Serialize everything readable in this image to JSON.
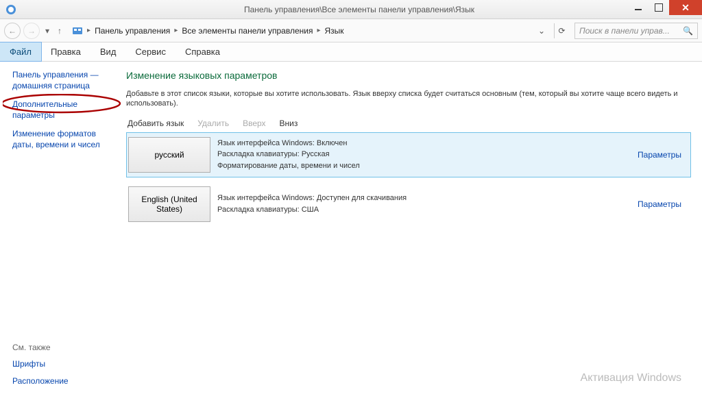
{
  "window": {
    "title": "Панель управления\\Все элементы панели управления\\Язык"
  },
  "nav": {
    "breadcrumb": [
      "Панель управления",
      "Все элементы панели управления",
      "Язык"
    ]
  },
  "search": {
    "placeholder": "Поиск в панели управ..."
  },
  "menu": {
    "file": "Файл",
    "edit": "Правка",
    "view": "Вид",
    "service": "Сервис",
    "help": "Справка"
  },
  "sidebar": {
    "home": "Панель управления — домашняя страница",
    "additional": "Дополнительные параметры",
    "dateformat": "Изменение форматов даты, времени и чисел",
    "see_also": "См. также",
    "fonts": "Шрифты",
    "location": "Расположение"
  },
  "content": {
    "heading": "Изменение языковых параметров",
    "description": "Добавьте в этот список языки, которые вы хотите использовать. Язык вверху списка будет считаться основным (тем, который вы хотите чаще всего видеть и использовать).",
    "toolbar": {
      "add": "Добавить язык",
      "remove": "Удалить",
      "up": "Вверх",
      "down": "Вниз"
    },
    "languages": [
      {
        "name": "русский",
        "line1": "Язык интерфейса Windows: Включен",
        "line2": "Раскладка клавиатуры: Русская",
        "line3": "Форматирование даты, времени и чисел",
        "options": "Параметры",
        "selected": true
      },
      {
        "name": "English (United States)",
        "line1": "Язык интерфейса Windows: Доступен для скачивания",
        "line2": "Раскладка клавиатуры: США",
        "line3": "",
        "options": "Параметры",
        "selected": false
      }
    ]
  },
  "watermark": "Активация Windows"
}
